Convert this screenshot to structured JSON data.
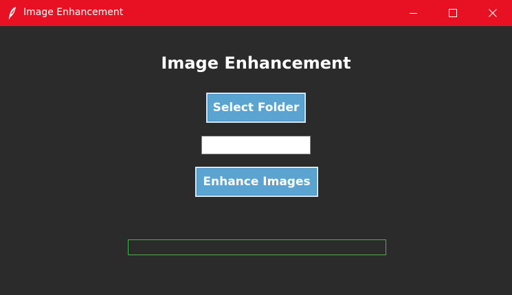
{
  "window": {
    "title": "Image Enhancement",
    "titlebar_color": "#e81123",
    "app_icon": "feather-icon",
    "controls": [
      "minimize-icon",
      "maximize-icon",
      "close-icon"
    ]
  },
  "main": {
    "heading": "Image Enhancement",
    "select_folder_label": "Select Folder",
    "folder_path_value": "",
    "enhance_label": "Enhance Images",
    "progress_fraction": 0,
    "background_color": "#2b2b2b",
    "button_color": "#5ba3d1",
    "progress_color": "#4caf50"
  }
}
